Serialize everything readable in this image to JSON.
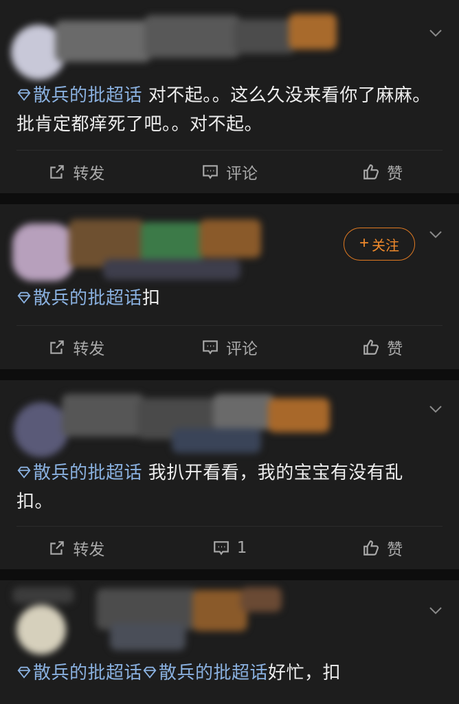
{
  "posts": [
    {
      "topic": "散兵的批超话",
      "text": " 对不起。。这么久没来看你了麻麻。批肯定都痒死了吧。。对不起。",
      "actions": {
        "repost": "转发",
        "comment": "评论",
        "like": "赞"
      }
    },
    {
      "follow_label": "关注",
      "topic": "散兵的批超话",
      "text": "扣",
      "actions": {
        "repost": "转发",
        "comment": "评论",
        "like": "赞"
      }
    },
    {
      "topic": "散兵的批超话",
      "text": " 我扒开看看，我的宝宝有没有乱扣。",
      "actions": {
        "repost": "转发",
        "comment": "1",
        "like": "赞"
      }
    },
    {
      "topic": "散兵的批超话",
      "topic2": "散兵的批超话",
      "text": "好忙，扣"
    }
  ],
  "colors": {
    "topic_link": "#8ab1e0",
    "follow_accent": "#f08a2c",
    "card_bg": "#1d1d1d",
    "page_bg": "#0d0d0d"
  },
  "icons": {
    "topic": "diamond-icon",
    "repost": "share-icon",
    "comment": "comment-icon",
    "like": "thumbs-up-icon",
    "menu": "chevron-down-icon"
  }
}
